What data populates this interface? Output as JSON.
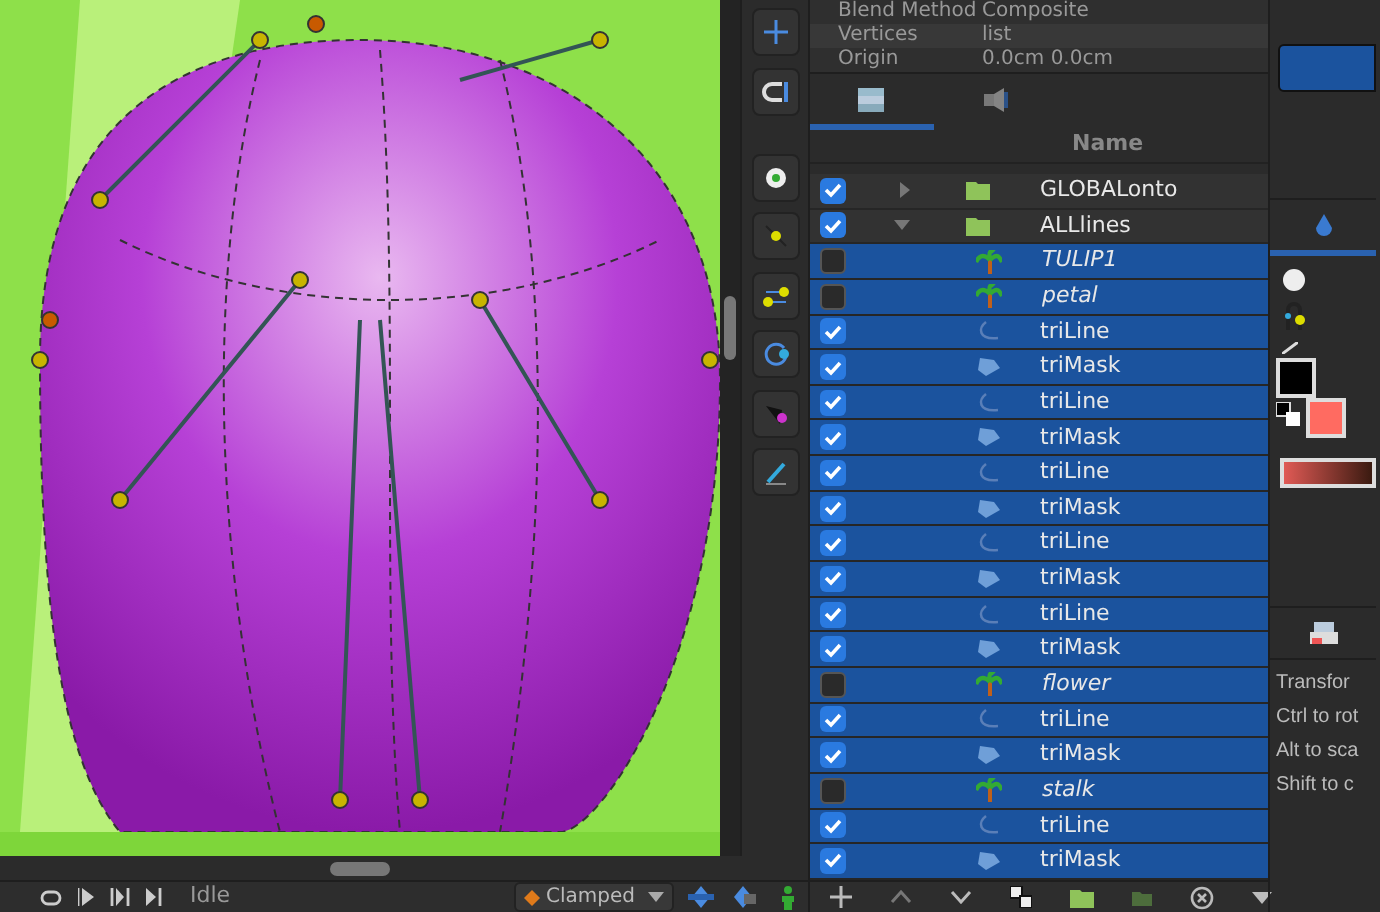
{
  "params": [
    {
      "name": "Blend Method",
      "value": "Composite"
    },
    {
      "name": "Vertices",
      "value": "list"
    },
    {
      "name": "Origin",
      "value": "0.0cm 0.0cm"
    }
  ],
  "panel_tabs": [
    {
      "kind": "layers",
      "selected": true
    },
    {
      "kind": "sound",
      "selected": false
    }
  ],
  "layers": {
    "column": "Name",
    "rows": [
      {
        "name": "GLOBALonto",
        "kind": "folder",
        "enabled": true,
        "selected": false,
        "expanded": false
      },
      {
        "name": "ALLlines",
        "kind": "folder",
        "enabled": true,
        "selected": false,
        "expanded": true,
        "children": [
          {
            "name": "TULIP1",
            "kind": "switch",
            "enabled": false,
            "selected": true
          },
          {
            "name": "petal",
            "kind": "switch",
            "enabled": false,
            "selected": true
          },
          {
            "name": "triLine",
            "kind": "outline",
            "enabled": true,
            "selected": true
          },
          {
            "name": "triMask",
            "kind": "region",
            "enabled": true,
            "selected": true
          },
          {
            "name": "triLine",
            "kind": "outline",
            "enabled": true,
            "selected": true
          },
          {
            "name": "triMask",
            "kind": "region",
            "enabled": true,
            "selected": true
          },
          {
            "name": "triLine",
            "kind": "outline",
            "enabled": true,
            "selected": true
          },
          {
            "name": "triMask",
            "kind": "region",
            "enabled": true,
            "selected": true
          },
          {
            "name": "triLine",
            "kind": "outline",
            "enabled": true,
            "selected": true
          },
          {
            "name": "triMask",
            "kind": "region",
            "enabled": true,
            "selected": true
          },
          {
            "name": "triLine",
            "kind": "outline",
            "enabled": true,
            "selected": true
          },
          {
            "name": "triMask",
            "kind": "region",
            "enabled": true,
            "selected": true
          },
          {
            "name": "flower",
            "kind": "switch",
            "enabled": false,
            "selected": true
          },
          {
            "name": "triLine",
            "kind": "outline",
            "enabled": true,
            "selected": true
          },
          {
            "name": "triMask",
            "kind": "region",
            "enabled": true,
            "selected": true
          },
          {
            "name": "stalk",
            "kind": "switch",
            "enabled": false,
            "selected": true
          },
          {
            "name": "triLine",
            "kind": "outline",
            "enabled": true,
            "selected": true
          },
          {
            "name": "triMask",
            "kind": "region",
            "enabled": true,
            "selected": true
          }
        ]
      }
    ]
  },
  "tool_hints": [
    "Transfor",
    "Ctrl to rot",
    "Alt to sca",
    "Shift to c"
  ],
  "playback": {
    "status": "Idle",
    "interpolation": "Clamped"
  }
}
